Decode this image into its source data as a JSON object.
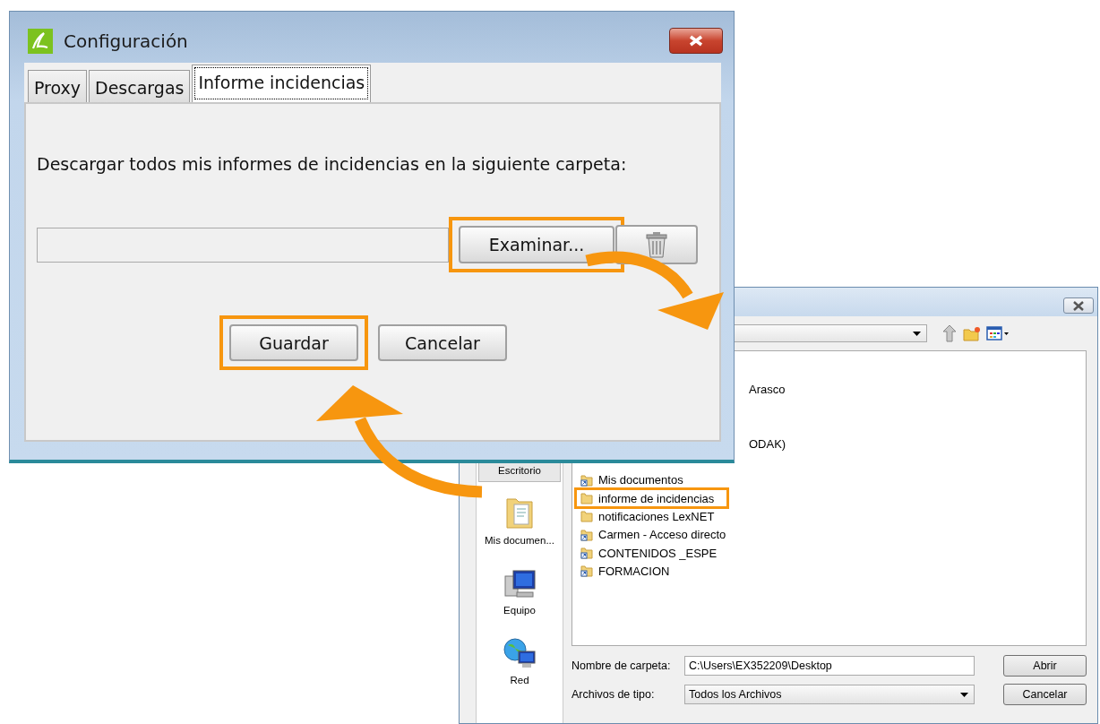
{
  "config_window": {
    "title": "Configuración",
    "tabs": [
      {
        "label": "Proxy",
        "selected": false
      },
      {
        "label": "Descargas",
        "selected": false
      },
      {
        "label": "Informe incidencias",
        "selected": true
      }
    ],
    "prompt": "Descargar todos mis informes de incidencias en la siguiente carpeta:",
    "browse_button": {
      "label": "Examinar...",
      "highlighted": true
    },
    "buttons": [
      {
        "label": "Guardar",
        "highlighted": true
      },
      {
        "label": "Cancelar",
        "highlighted": false
      }
    ]
  },
  "folder_dialog": {
    "sidebar": [
      {
        "label": "Escritorio",
        "kind": "desktop",
        "selected": true
      },
      {
        "label": "Mis documen...",
        "kind": "documents",
        "selected": false
      },
      {
        "label": "Equipo",
        "kind": "computer",
        "selected": false
      },
      {
        "label": "Red",
        "kind": "network",
        "selected": false
      }
    ],
    "files": [
      {
        "name": "Arasco",
        "kind": "partial",
        "highlighted": false
      },
      {
        "name": "ODAK)",
        "kind": "partial",
        "highlighted": false
      },
      {
        "name": "Mis documentos",
        "kind": "shortcut",
        "highlighted": false
      },
      {
        "name": "informe de incidencias",
        "kind": "folder",
        "highlighted": true
      },
      {
        "name": "notificaciones LexNET",
        "kind": "folder",
        "highlighted": false
      },
      {
        "name": "Carmen - Acceso directo",
        "kind": "shortcut",
        "highlighted": false
      },
      {
        "name": "CONTENIDOS _ESPE",
        "kind": "shortcut",
        "highlighted": false
      },
      {
        "name": "FORMACION",
        "kind": "shortcut",
        "highlighted": false
      }
    ],
    "folder_name_label": "Nombre de carpeta:",
    "folder_name_value": "C:\\Users\\EX352209\\Desktop",
    "file_type_label": "Archivos de tipo:",
    "file_type_value": "Todos los Archivos",
    "buttons": [
      "Abrir",
      "Cancelar"
    ]
  }
}
